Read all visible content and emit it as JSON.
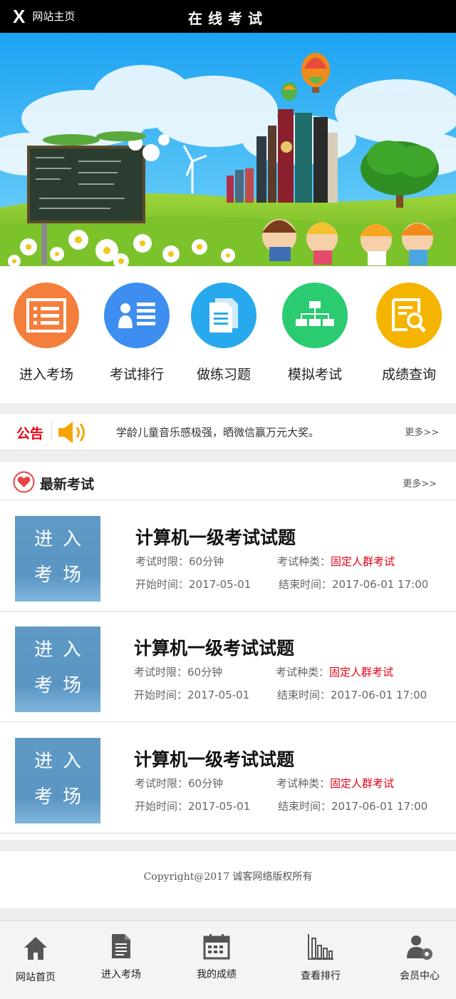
{
  "header": {
    "home_glyph": "X",
    "home_label": "网站主页",
    "title": "在线考试"
  },
  "banner": {
    "description_icon": "banner-illustration"
  },
  "quick_nav": [
    {
      "label": "进入考场",
      "icon": "list-icon",
      "color": "#f47f3c"
    },
    {
      "label": "考试排行",
      "icon": "ranking-icon",
      "color": "#3d8ef0"
    },
    {
      "label": "做练习题",
      "icon": "document-icon",
      "color": "#28a9ee"
    },
    {
      "label": "模拟考试",
      "icon": "hierarchy-icon",
      "color": "#2bcb72"
    },
    {
      "label": "成绩查询",
      "icon": "search-report-icon",
      "color": "#f5b400"
    }
  ],
  "notice": {
    "tag": "公告",
    "text": "学龄儿童音乐感极强，晒微信赢万元大奖。",
    "more": "更多>>"
  },
  "latest": {
    "title": "最新考试",
    "more": "更多>>"
  },
  "exams": [
    {
      "enter_line1": "进入",
      "enter_line2": "考场",
      "title": "计算机一级考试试题",
      "duration_label": "考试时限：",
      "duration": "60分钟",
      "type_label": "考试种类：",
      "type": "固定人群考试",
      "start_label": "开始时间：",
      "start": "2017-05-01",
      "end_label": "结束时间：",
      "end": "2017-06-01 17:00"
    },
    {
      "enter_line1": "进入",
      "enter_line2": "考场",
      "title": "计算机一级考试试题",
      "duration_label": "考试时限：",
      "duration": "60分钟",
      "type_label": "考试种类：",
      "type": "固定人群考试",
      "start_label": "开始时间：",
      "start": "2017-05-01",
      "end_label": "结束时间：",
      "end": "2017-06-01 17:00"
    },
    {
      "enter_line1": "进入",
      "enter_line2": "考场",
      "title": "计算机一级考试试题",
      "duration_label": "考试时限：",
      "duration": "60分钟",
      "type_label": "考试种类：",
      "type": "固定人群考试",
      "start_label": "开始时间：",
      "start": "2017-05-01",
      "end_label": "结束时间：",
      "end": "2017-06-01 17:00"
    }
  ],
  "footer": {
    "copyright": "Copyright@2017 诚客网络版权所有"
  },
  "tabbar": [
    {
      "label": "网站首页",
      "icon": "home-icon"
    },
    {
      "label": "进入考场",
      "icon": "document-icon"
    },
    {
      "label": "我的成绩",
      "icon": "calendar-icon"
    },
    {
      "label": "查看排行",
      "icon": "bar-chart-icon"
    },
    {
      "label": "会员中心",
      "icon": "user-settings-icon"
    }
  ],
  "colors": {
    "header_bg": "#000000",
    "accent_red": "#e60012",
    "enter_box": "#5b96c3"
  }
}
